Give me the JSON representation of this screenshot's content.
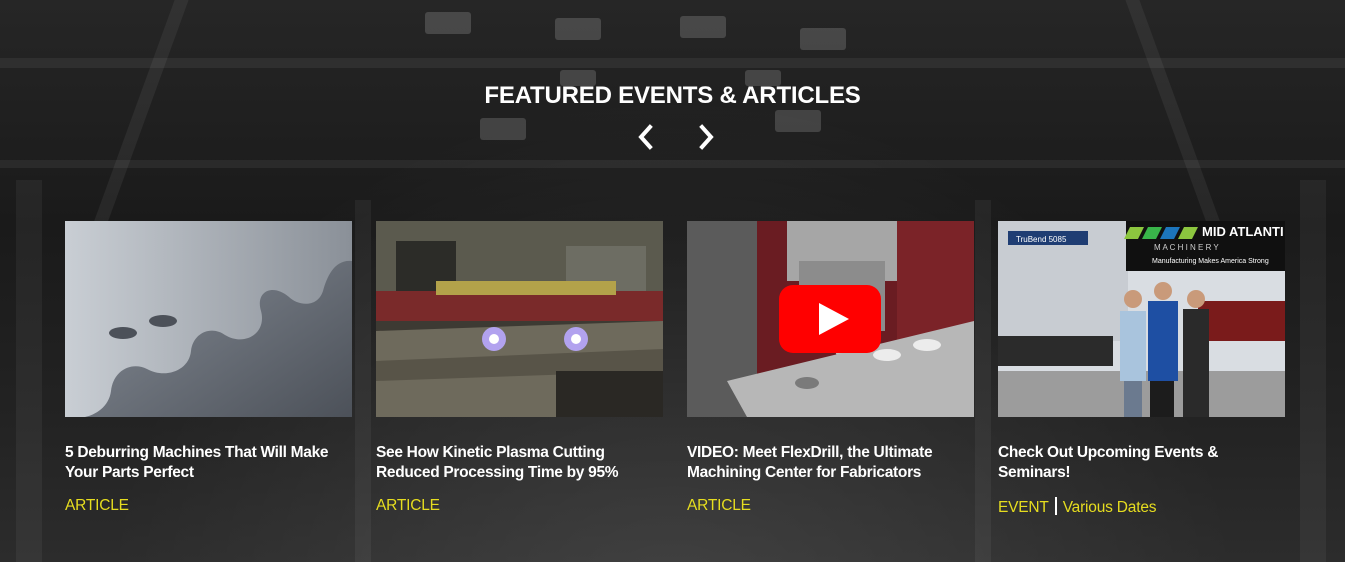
{
  "section": {
    "title": "FEATURED EVENTS & ARTICLES"
  },
  "nav": {
    "prev_icon": "chevron-left-icon",
    "next_icon": "chevron-right-icon"
  },
  "colors": {
    "accent": "#e6dd1f",
    "title": "#ffffff",
    "play": "#ff0000"
  },
  "cards": [
    {
      "title": "5 Deburring Machines That Will Make Your Parts Perfect",
      "type": "ARTICLE"
    },
    {
      "title": "See How Kinetic Plasma Cutting Reduced Processing Time by 95%",
      "type": "ARTICLE"
    },
    {
      "title": "VIDEO: Meet FlexDrill, the Ultimate Machining Center for Fabricators",
      "type": "ARTICLE"
    },
    {
      "title": "Check Out Upcoming Events & Seminars!",
      "type": "EVENT",
      "date": "Various Dates",
      "thumb_banner": {
        "brand_line1": "MID ATLANTI",
        "brand_line2": "M A C H I N E R Y",
        "tagline": "Manufacturing Makes America Strong",
        "machine_label": "TruBend 5085"
      }
    }
  ]
}
